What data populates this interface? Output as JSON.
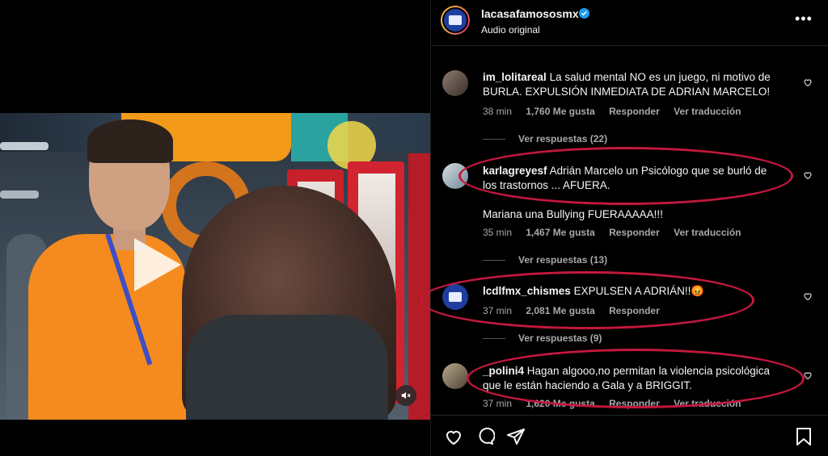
{
  "header": {
    "account": "lacasafamososmx",
    "audio": "Audio original",
    "more": "•••"
  },
  "comments": [
    {
      "user": "im_lolitareal",
      "text1": "La salud mental NO es un juego, ni motivo de",
      "text2": "BURLA. EXPULSIÓN INMEDIATA DE ADRIAN MARCELO!",
      "time": "38 min",
      "likes": "1,760 Me gusta",
      "reply": "Responder",
      "translate": "Ver traducción",
      "replies": "Ver respuestas (22)"
    },
    {
      "user": "karlagreyesf",
      "text1": "Adrián Marcelo un Psicólogo que se burló de",
      "text2": "los trastornos ... AFUERA.",
      "text3": "Mariana una Bullying FUERAAAAA!!!",
      "time": "35 min",
      "likes": "1,467 Me gusta",
      "reply": "Responder",
      "translate": "Ver traducción",
      "replies": "Ver respuestas (13)"
    },
    {
      "user": "lcdlfmx_chismes",
      "text1": "EXPULSEN A ADRIÁN!!😡",
      "time": "37 min",
      "likes": "2,081 Me gusta",
      "reply": "Responder",
      "replies": "Ver respuestas (9)"
    },
    {
      "user": "_polini4",
      "text1": "Hagan algooo,no permitan la violencia psicológica",
      "text2": "que le están haciendo a Gala y a BRIGGIT.",
      "time": "37 min",
      "likes": "1,620 Me gusta",
      "reply": "Responder",
      "translate": "Ver traducción"
    }
  ],
  "icons": {
    "like": "heart-icon",
    "comment": "comment-icon",
    "share": "send-icon",
    "save": "bookmark-icon",
    "video_play": "play-icon",
    "video_mute": "muted-speaker-icon",
    "verified": "verified-badge-icon"
  },
  "colors": {
    "highlight": "#c2183d",
    "verified": "#1d9bf0",
    "background": "#000000"
  }
}
